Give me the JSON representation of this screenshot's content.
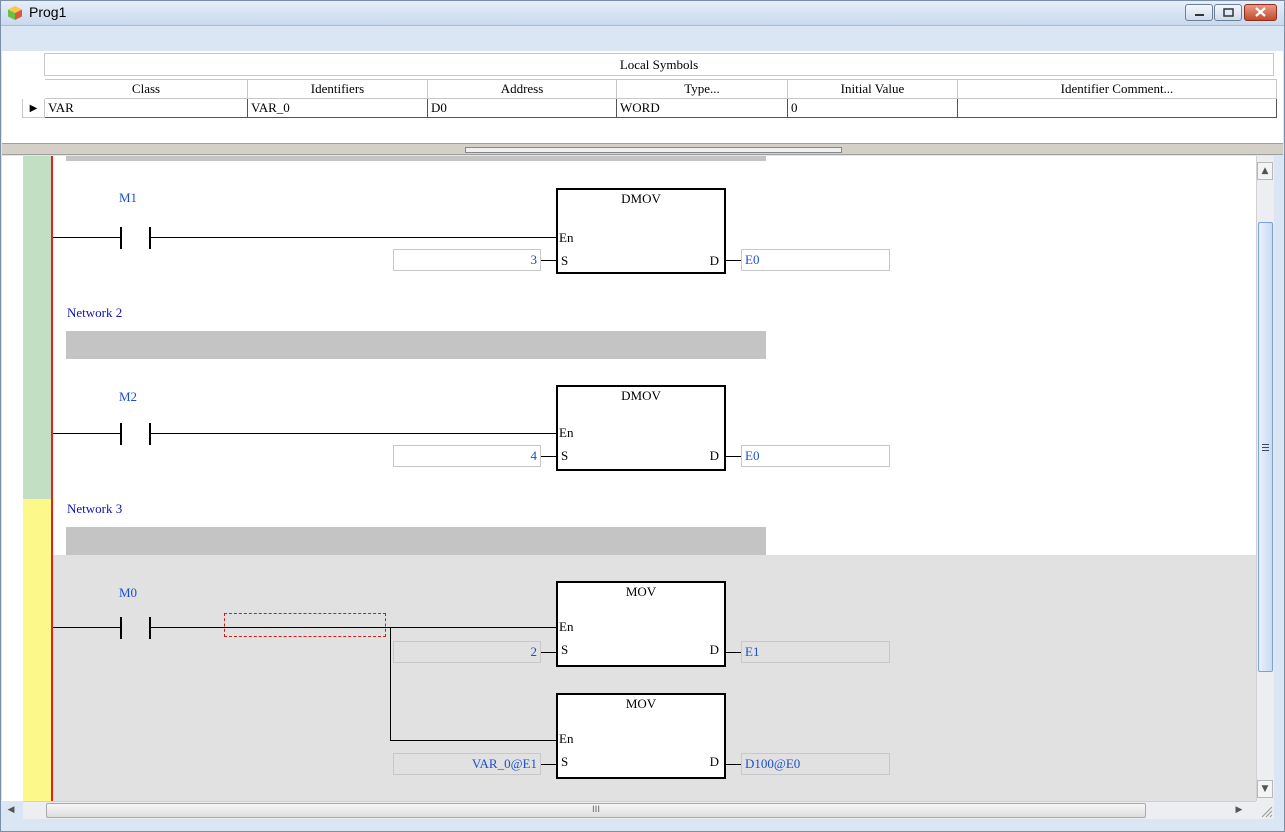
{
  "window": {
    "title": "Prog1"
  },
  "symbols": {
    "title": "Local Symbols",
    "columns": [
      "Class",
      "Identifiers",
      "Address",
      "Type...",
      "Initial Value",
      "Identifier Comment..."
    ],
    "rows": [
      {
        "class": "VAR",
        "identifier": "VAR_0",
        "address": "D0",
        "type": "WORD",
        "initial": "0",
        "comment": ""
      }
    ]
  },
  "ladder": {
    "networks": [
      {
        "label": "",
        "contact": "M1",
        "blocks": [
          {
            "name": "DMOV",
            "en": "En",
            "s_pin": "S",
            "d_pin": "D",
            "s_value": "3",
            "d_value": "E0"
          }
        ]
      },
      {
        "label": "Network 2",
        "contact": "M2",
        "blocks": [
          {
            "name": "DMOV",
            "en": "En",
            "s_pin": "S",
            "d_pin": "D",
            "s_value": "4",
            "d_value": "E0"
          }
        ]
      },
      {
        "label": "Network 3",
        "contact": "M0",
        "blocks": [
          {
            "name": "MOV",
            "en": "En",
            "s_pin": "S",
            "d_pin": "D",
            "s_value": "2",
            "d_value": "E1"
          },
          {
            "name": "MOV",
            "en": "En",
            "s_pin": "S",
            "d_pin": "D",
            "s_value": "VAR_0@E1",
            "d_value": "D100@E0"
          }
        ]
      }
    ]
  },
  "colors": {
    "power_rail": "#e8201c",
    "operand_text": "#1a4fd0",
    "network_label": "#1010c0",
    "gutter_done": "#c3dfc3",
    "gutter_active": "#fdf88a"
  },
  "scrollbar": {
    "grip_label": "III"
  }
}
